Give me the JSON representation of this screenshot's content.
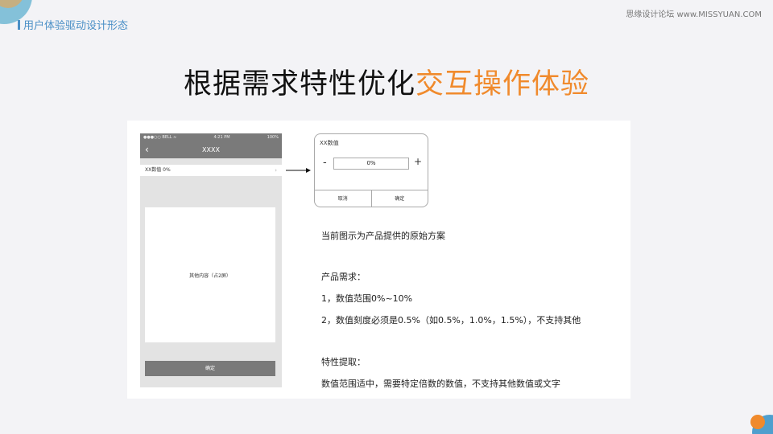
{
  "header": {
    "section_tag": "用户体验驱动设计形态",
    "watermark": "思缘设计论坛 www.MISSYUAN.COM"
  },
  "title": {
    "part1": "根据需求特性优化",
    "part2": "交互操作体验"
  },
  "colors": {
    "accent": "#f08a2c",
    "tag": "#4a8fc6",
    "phone_gray": "#7a7a7a"
  },
  "phone": {
    "status_left": "●●●○○ BELL ≈",
    "status_time": "4:21 PM",
    "status_right": "100%",
    "nav_title": "XXXX",
    "row_label": "XX数值 0%",
    "content_label": "其他内容（占2屏）",
    "confirm": "确定"
  },
  "popup": {
    "title": "XX数值",
    "minus": "-",
    "value": "0%",
    "plus": "+",
    "cancel": "取消",
    "confirm": "确定"
  },
  "description": {
    "line1": "当前图示为产品提供的原始方案",
    "req_title": "产品需求：",
    "req1": "1，数值范围0%~10%",
    "req2": "2，数值刻度必须是0.5%（如0.5%，1.0%，1.5%），不支持其他",
    "feat_title": "特性提取：",
    "feat1": "数值范围适中，需要特定倍数的数值，不支持其他数值或文字"
  }
}
